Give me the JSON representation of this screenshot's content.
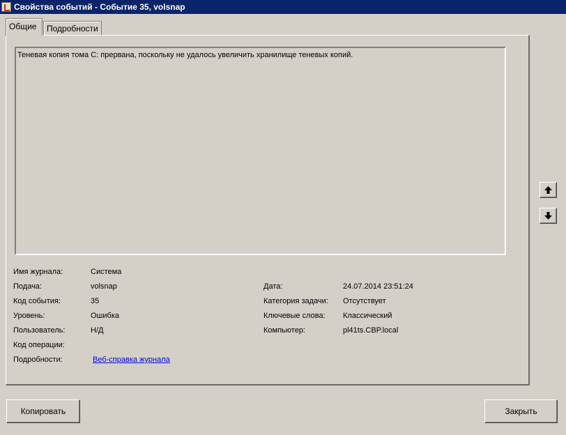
{
  "window": {
    "title": "Свойства событий - Событие 35, volsnap"
  },
  "tabs": [
    {
      "label": "Общие",
      "active": true
    },
    {
      "label": "Подробности",
      "active": false
    }
  ],
  "message": "Теневая копия тома C: прервана, поскольку не удалось увеличить хранилище теневых копий.",
  "fields": {
    "log_name": {
      "label": "Имя журнала:",
      "value": "Система"
    },
    "source": {
      "label": "Подача:",
      "value": "volsnap"
    },
    "event_id": {
      "label": "Код события:",
      "value": "35"
    },
    "level": {
      "label": "Уровень:",
      "value": "Ошибка"
    },
    "user": {
      "label": "Пользователь:",
      "value": "Н/Д"
    },
    "opcode": {
      "label": "Код операции:",
      "value": ""
    },
    "details": {
      "label": "Подробности:",
      "link": "Веб-справка журнала"
    },
    "date": {
      "label": "Дата:",
      "value": "24.07.2014 23:51:24"
    },
    "task_category": {
      "label": "Категория задачи:",
      "value": "Отсутствует"
    },
    "keywords": {
      "label": "Ключевые слова:",
      "value": "Классический"
    },
    "computer": {
      "label": "Компьютер:",
      "value": "pl41ts.CBP.local"
    }
  },
  "buttons": {
    "copy": "Копировать",
    "close": "Закрыть"
  },
  "icons": {
    "scroll_up": "arrow-up-icon",
    "scroll_down": "arrow-down-icon"
  }
}
